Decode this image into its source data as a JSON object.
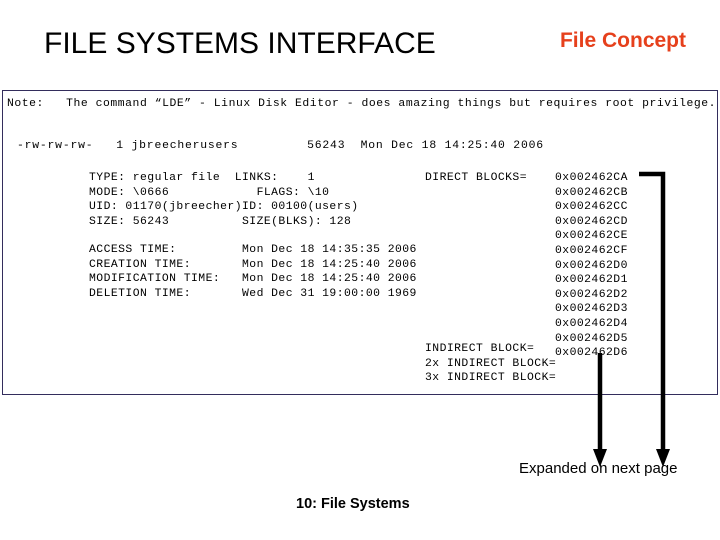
{
  "slide": {
    "title": "FILE SYSTEMS INTERFACE",
    "subtitle": "File Concept",
    "subtitle_color": "#e6401c",
    "footer": "10: File Systems",
    "expanded_note": "Expanded on next page"
  },
  "terminal": {
    "border_color": "#332d5c",
    "note_line": "Note:   The command “LDE” - Linux Disk Editor - does amazing things but requires root privilege.",
    "listing_line": "-rw-rw-rw-   1 jbreecherusers         56243  Mon Dec 18 14:25:40 2006",
    "inode_left_block": "TYPE: regular file  LINKS:    1\nMODE: \\0666            FLAGS: \\10\nUID: 01170(jbreecher)ID: 00100(users)\nSIZE: 56243          SIZE(BLKS): 128",
    "inode_times_block": "ACCESS TIME:         Mon Dec 18 14:35:35 2006\nCREATION TIME:       Mon Dec 18 14:25:40 2006\nMODIFICATION TIME:   Mon Dec 18 14:25:40 2006\nDELETION TIME:       Wed Dec 31 19:00:00 1969",
    "direct_blocks_label": "DIRECT BLOCKS=",
    "indirect_labels_block": "INDIRECT BLOCK=\n2x INDIRECT BLOCK=\n3x INDIRECT BLOCK=",
    "block_addresses_block": "0x002462CA\n0x002462CB\n0x002462CC\n0x002462CD\n0x002462CE\n0x002462CF\n0x002462D0\n0x002462D1\n0x002462D2\n0x002462D3\n0x002462D4\n0x002462D5\n0x002462D6",
    "fields": {
      "type_label": "TYPE:",
      "type_value": "regular file",
      "links_label": "LINKS:",
      "links_value": "1",
      "mode_label": "MODE:",
      "mode_value": "\\0666",
      "flags_label": "FLAGS:",
      "flags_value": "\\10",
      "uid_label": "UID:",
      "uid_value": "01170(jbreecher)",
      "gid_label": "ID:",
      "gid_value": "00100(users)",
      "size_label": "SIZE:",
      "size_value": "56243",
      "size_blks_label": "SIZE(BLKS):",
      "size_blks_value": "128",
      "access_time_label": "ACCESS TIME:",
      "access_time_value": "Mon Dec 18 14:35:35 2006",
      "creation_time_label": "CREATION TIME:",
      "creation_time_value": "Mon Dec 18 14:25:40 2006",
      "modification_time_label": "MODIFICATION TIME:",
      "modification_time_value": "Mon Dec 18 14:25:40 2006",
      "deletion_time_label": "DELETION TIME:",
      "deletion_time_value": "Wed Dec 31 19:00:00 1969"
    },
    "block_addresses": [
      "0x002462CA",
      "0x002462CB",
      "0x002462CC",
      "0x002462CD",
      "0x002462CE",
      "0x002462CF",
      "0x002462D0",
      "0x002462D1",
      "0x002462D2",
      "0x002462D3",
      "0x002462D4",
      "0x002462D5",
      "0x002462D6"
    ],
    "indirect_rows": [
      "INDIRECT BLOCK=",
      "2x INDIRECT BLOCK=",
      "3x INDIRECT BLOCK="
    ]
  },
  "annotations": {
    "arrow_color": "#000000",
    "direct_blocks_arrow": "arrow-direct-blocks",
    "indirect_blocks_arrow": "arrow-indirect-blocks"
  }
}
